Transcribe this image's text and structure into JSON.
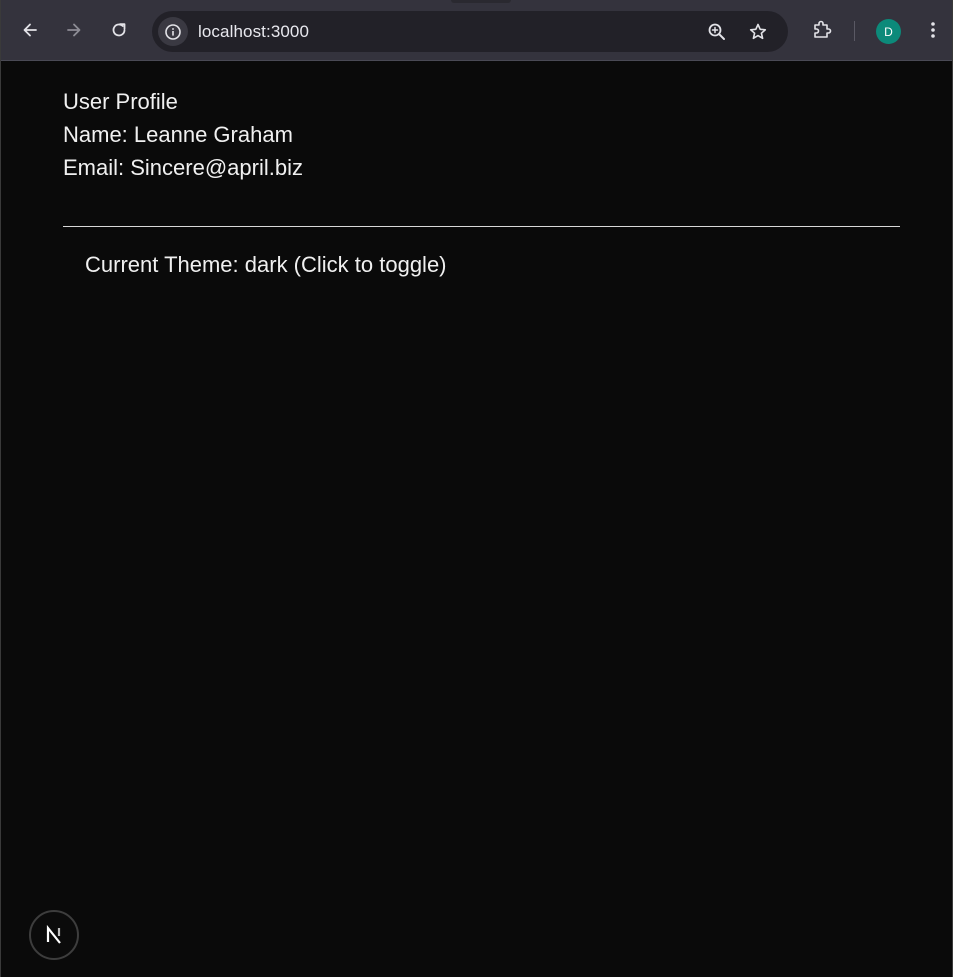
{
  "browser": {
    "url": "localhost:3000",
    "profile_initial": "D",
    "colors": {
      "toolbar": "#34333d",
      "omnibox": "#222128",
      "avatar": "#0c8a7a"
    },
    "icons": {
      "back": "arrow-left-icon",
      "forward": "arrow-right-icon",
      "reload": "reload-icon",
      "site_info": "info-icon",
      "zoom": "zoom-in-icon",
      "bookmark": "star-icon",
      "extensions": "puzzle-icon",
      "menu": "kebab-menu-icon"
    }
  },
  "page": {
    "background": "#0a0a0a",
    "profile": {
      "heading": "User Profile",
      "name_line": "Name: Leanne Graham",
      "email_line": "Email: Sincere@april.biz"
    },
    "theme_toggle": "Current Theme: dark (Click to toggle)",
    "dev_badge": {
      "icon": "nextjs-logo-icon",
      "letter": "N"
    }
  }
}
